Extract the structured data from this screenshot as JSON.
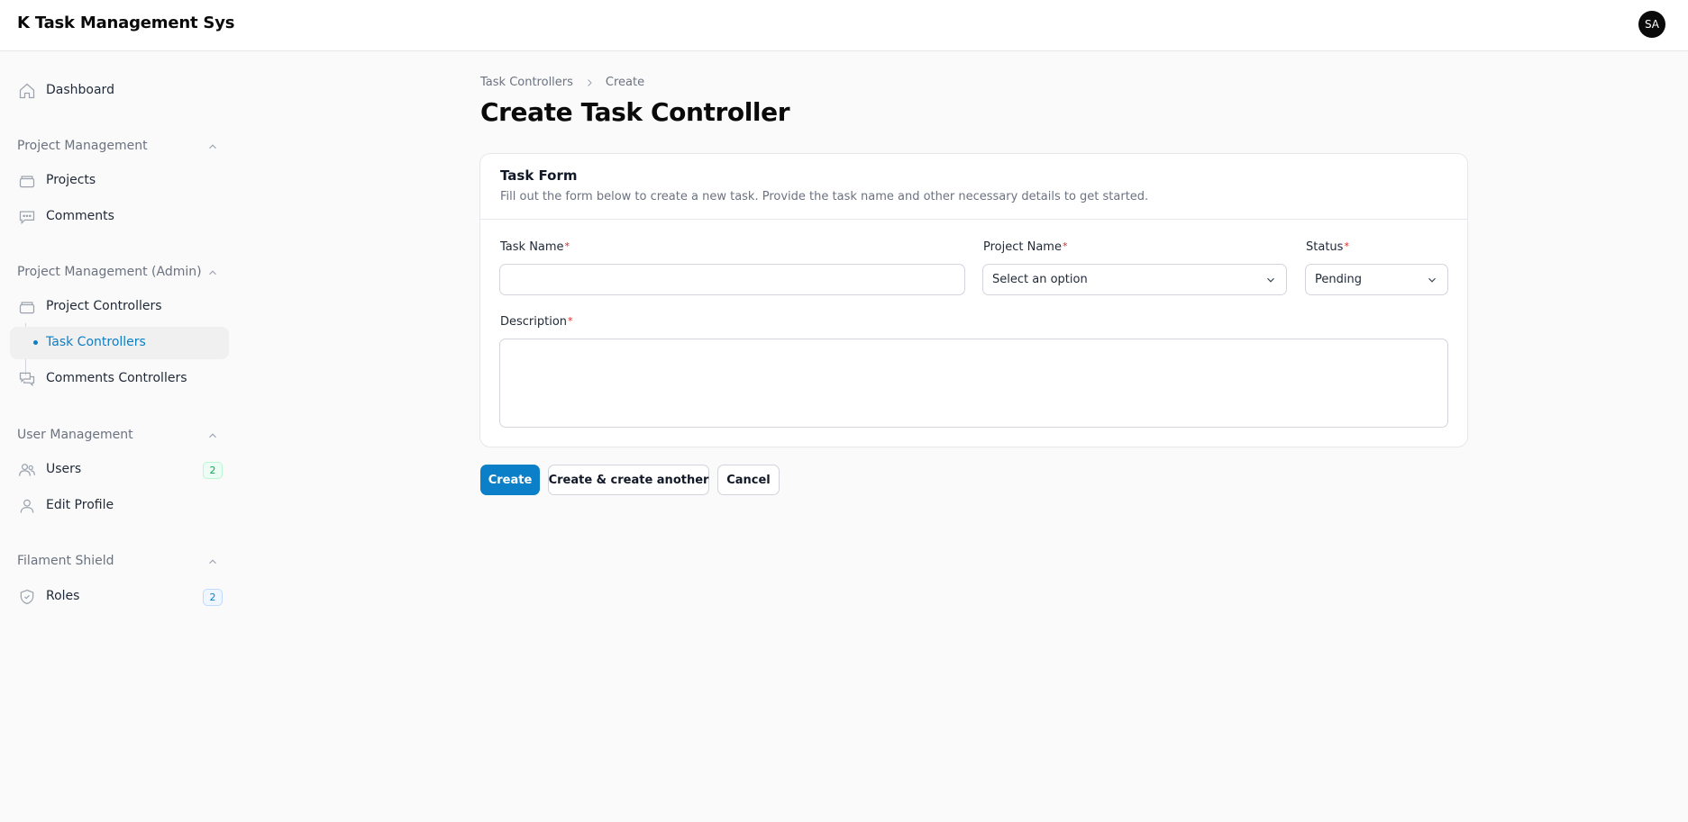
{
  "app": {
    "title": "K Task Management Sys",
    "avatar_initials": "SA"
  },
  "sidebar": {
    "dashboard": {
      "label": "Dashboard",
      "icon": "home-icon"
    },
    "groups": [
      {
        "label": "Project Management",
        "items": [
          {
            "label": "Projects",
            "icon": "folder-icon"
          },
          {
            "label": "Comments",
            "icon": "chat-bubble-icon"
          }
        ]
      },
      {
        "label": "Project Management (Admin)",
        "items": [
          {
            "label": "Project Controllers",
            "icon": "folder-icon"
          },
          {
            "label": "Task Controllers",
            "active": true
          },
          {
            "label": "Comments Controllers",
            "icon": "chat-bubbles-icon"
          }
        ]
      },
      {
        "label": "User Management",
        "items": [
          {
            "label": "Users",
            "icon": "users-icon",
            "badge": "2"
          },
          {
            "label": "Edit Profile",
            "icon": "user-icon"
          }
        ]
      },
      {
        "label": "Filament Shield",
        "items": [
          {
            "label": "Roles",
            "icon": "shield-icon",
            "badge": "2"
          }
        ]
      }
    ]
  },
  "breadcrumb": [
    "Task Controllers",
    "Create"
  ],
  "page_title": "Create Task Controller",
  "form": {
    "title": "Task Form",
    "description": "Fill out the form below to create a new task. Provide the task name and other necessary details to get started.",
    "required_mark": "*",
    "task_name": {
      "label": "Task Name",
      "value": ""
    },
    "project_name": {
      "label": "Project Name",
      "value": "Select an option"
    },
    "status": {
      "label": "Status",
      "value": "Pending"
    },
    "description_field": {
      "label": "Description",
      "value": ""
    }
  },
  "actions": {
    "create": "Create",
    "create_another": "Create & create another",
    "cancel": "Cancel"
  },
  "colors": {
    "primary": "#0b7fc7",
    "required": "#dc2626"
  }
}
